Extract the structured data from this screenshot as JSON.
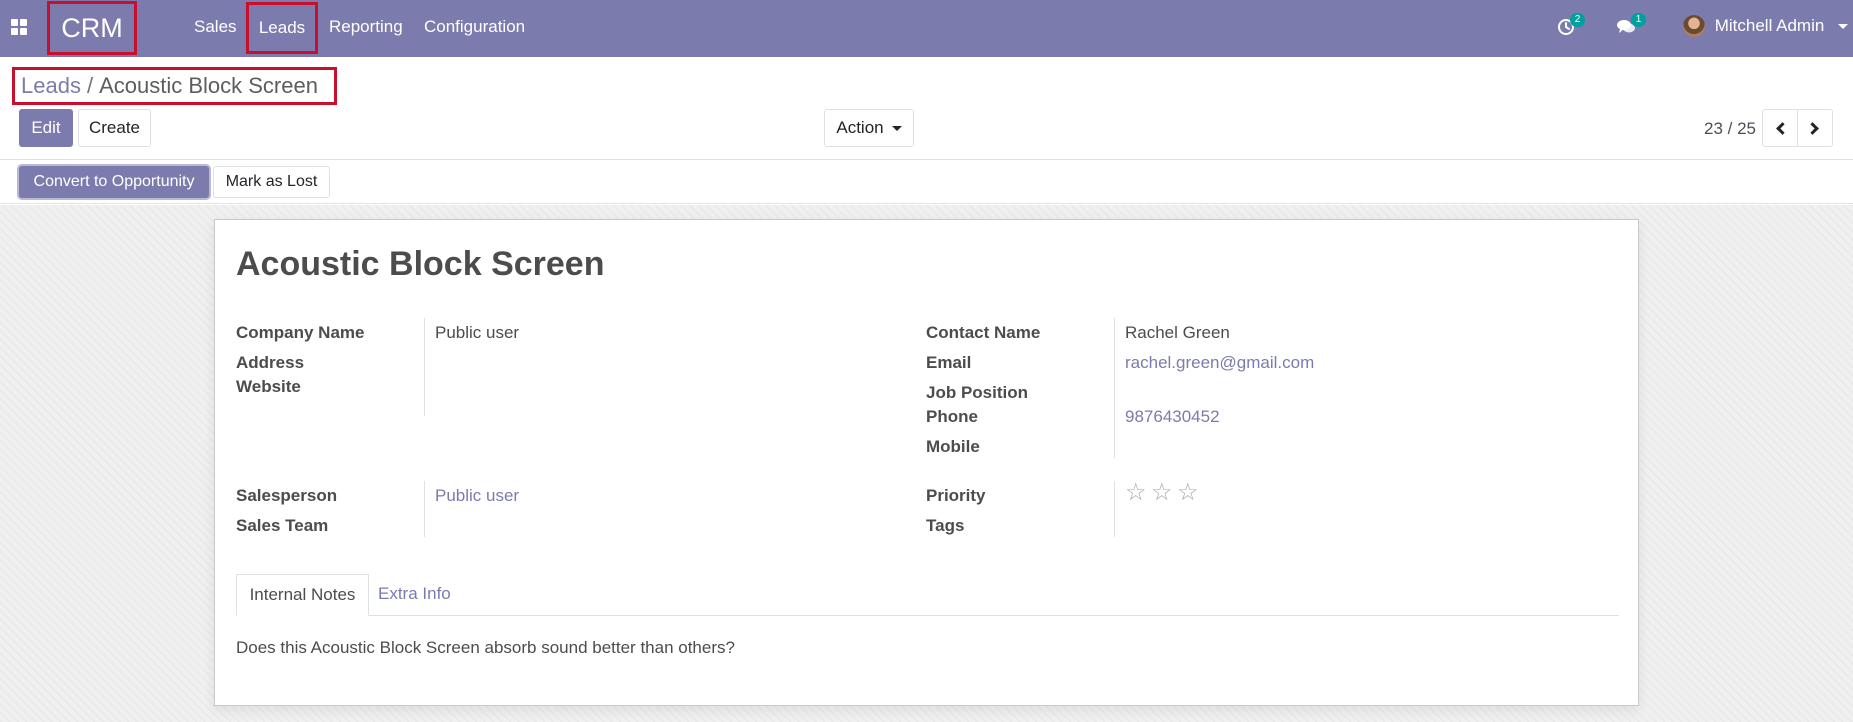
{
  "navbar": {
    "brand": "CRM",
    "menu": [
      "Sales",
      "Leads",
      "Reporting",
      "Configuration"
    ],
    "activity_count": "2",
    "message_count": "1",
    "user_name": "Mitchell Admin"
  },
  "breadcrumb": {
    "parent": "Leads",
    "separator": "/",
    "current": "Acoustic Block Screen"
  },
  "toolbar": {
    "edit_label": "Edit",
    "create_label": "Create",
    "action_label": "Action",
    "pager": "23 / 25"
  },
  "statusbar": {
    "convert_label": "Convert to Opportunity",
    "lost_label": "Mark as Lost"
  },
  "form": {
    "title": "Acoustic Block Screen",
    "left_group": {
      "company_name_label": "Company Name",
      "company_name_value": "Public user",
      "address_label": "Address",
      "website_label": "Website"
    },
    "right_group": {
      "contact_name_label": "Contact Name",
      "contact_name_value": "Rachel Green",
      "email_label": "Email",
      "email_value": "rachel.green@gmail.com",
      "job_position_label": "Job Position",
      "phone_label": "Phone",
      "phone_value": "9876430452",
      "mobile_label": "Mobile"
    },
    "left_group2": {
      "salesperson_label": "Salesperson",
      "salesperson_value": "Public user",
      "sales_team_label": "Sales Team"
    },
    "right_group2": {
      "priority_label": "Priority",
      "priority_stars_filled": 0,
      "priority_stars_total": 3,
      "tags_label": "Tags"
    },
    "tabs": [
      "Internal Notes",
      "Extra Info"
    ],
    "notes": "Does this Acoustic Block Screen absorb sound better than others?"
  },
  "colors": {
    "brand": "#7c7bad",
    "highlight_border": "#c8102e",
    "badge": "#00a09d"
  },
  "icons": [
    "apps-grid-icon",
    "clock-activity-icon",
    "chat-bubbles-icon",
    "chevron-left-icon",
    "chevron-right-icon",
    "star-icon"
  ]
}
